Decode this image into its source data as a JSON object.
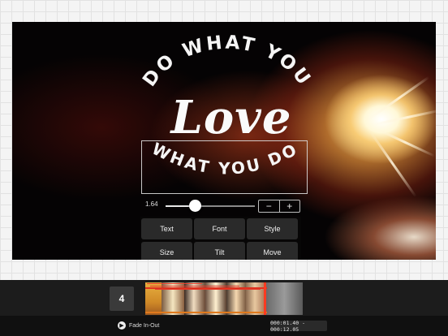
{
  "canvas": {
    "headline_top": "DO WHAT YOU",
    "headline_middle": "Love",
    "headline_bottom": "WHAT YOU DO"
  },
  "size_slider": {
    "value_label": "1.64",
    "fraction": 0.33
  },
  "stepper": {
    "minus_label": "−",
    "plus_label": "+"
  },
  "edit_menu": {
    "buttons": [
      "Text",
      "Font",
      "Style",
      "Size",
      "Tilt",
      "Move"
    ]
  },
  "timeline": {
    "clip_count": "4"
  },
  "toolbar": {
    "transition_label": "Fade In-Out",
    "time_range": "000:01.40 - 000:12.05"
  },
  "colors": {
    "playhead": "#ff3a20",
    "trim_handle": "#e0301e",
    "background": "#050304"
  }
}
